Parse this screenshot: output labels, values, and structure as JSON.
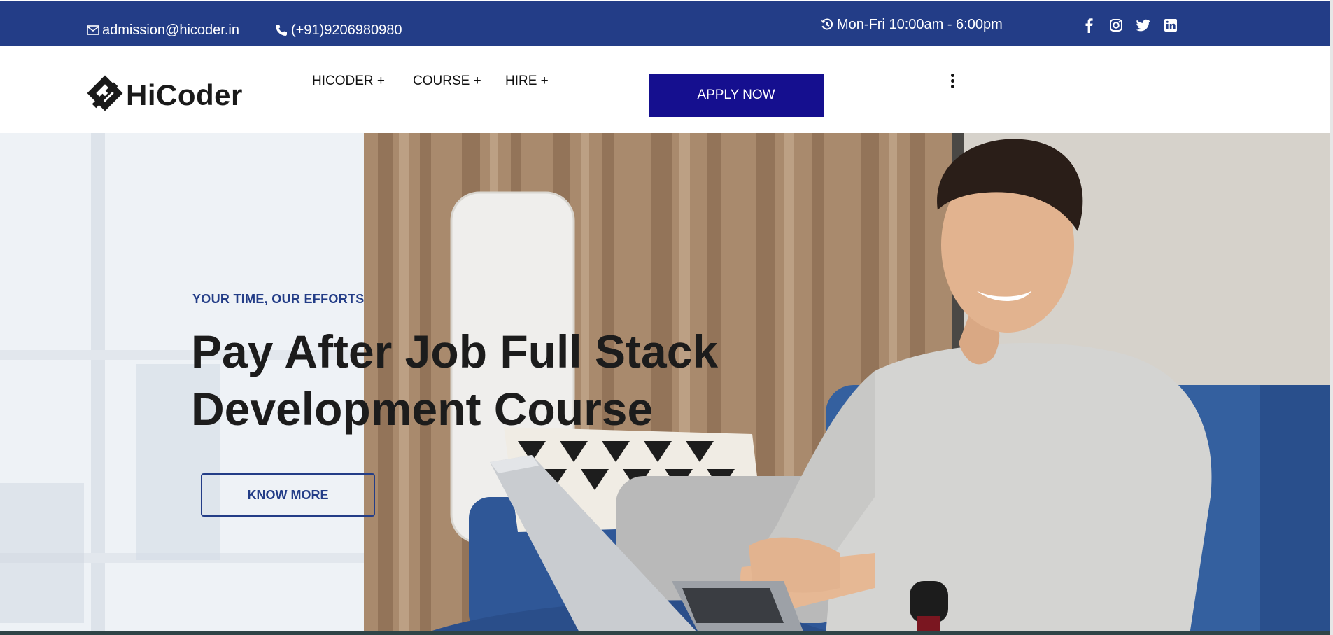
{
  "topbar": {
    "email": "admission@hicoder.in",
    "phone": "(+91)9206980980",
    "hours": "Mon-Fri 10:00am - 6:00pm",
    "social_icons": [
      "facebook-icon",
      "instagram-icon",
      "twitter-icon",
      "linkedin-icon"
    ],
    "bg_color": "#233d87"
  },
  "header": {
    "logo_text": "HiCoder",
    "nav": [
      {
        "label": "HICODER +"
      },
      {
        "label": "COURSE +"
      },
      {
        "label": "HIRE +"
      }
    ],
    "apply_label": "APPLY NOW",
    "apply_color": "#150f8f",
    "menu_icon": "vertical-dots-icon"
  },
  "hero": {
    "tagline": "YOUR TIME, OUR EFFORTS",
    "title_line1": "Pay After Job Full Stack",
    "title_line2": "Development Course",
    "cta_label": "KNOW MORE",
    "image_icon": "man-on-laptop-photo"
  }
}
